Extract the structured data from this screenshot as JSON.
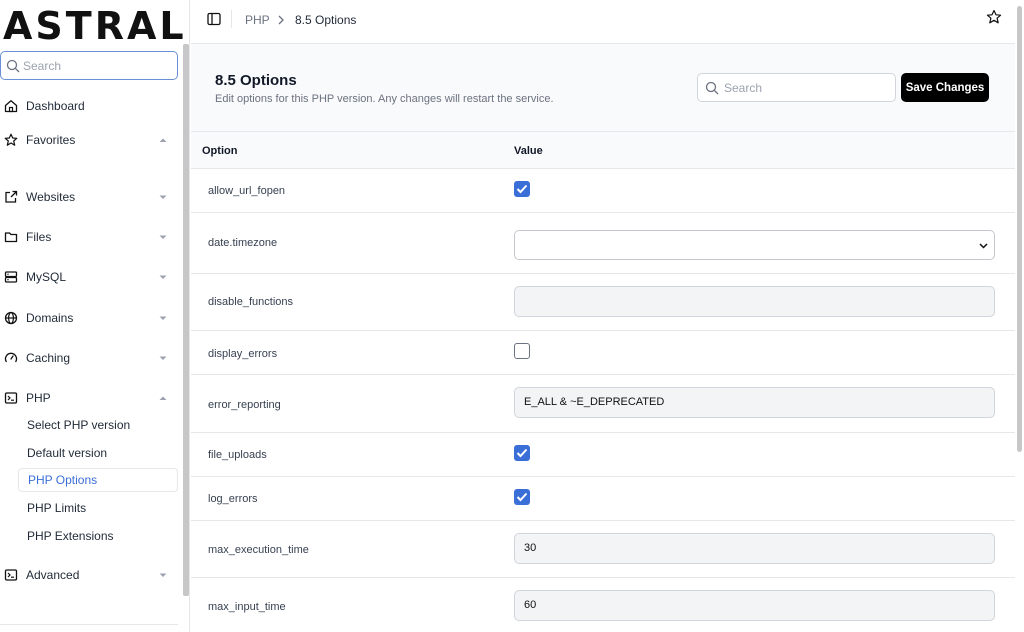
{
  "brand": {
    "logo_text": "ASTRAL"
  },
  "sidebar": {
    "search_placeholder": "Search",
    "items": [
      {
        "label": "Dashboard",
        "icon": "home-icon"
      },
      {
        "label": "Favorites",
        "icon": "star-icon",
        "expanded": true
      },
      {
        "label": "Websites",
        "icon": "external-link-icon",
        "expanded": false
      },
      {
        "label": "Files",
        "icon": "folder-icon",
        "expanded": false
      },
      {
        "label": "MySQL",
        "icon": "server-icon",
        "expanded": false
      },
      {
        "label": "Domains",
        "icon": "globe-icon",
        "expanded": false
      },
      {
        "label": "Caching",
        "icon": "gauge-icon",
        "expanded": false
      },
      {
        "label": "PHP",
        "icon": "terminal-icon",
        "expanded": true
      },
      {
        "label": "Advanced",
        "icon": "terminal-icon",
        "expanded": false
      }
    ],
    "php_subitems": [
      {
        "label": "Select PHP version",
        "active": false
      },
      {
        "label": "Default version",
        "active": false
      },
      {
        "label": "PHP Options",
        "active": true
      },
      {
        "label": "PHP Limits",
        "active": false
      },
      {
        "label": "PHP Extensions",
        "active": false
      }
    ]
  },
  "topbar": {
    "breadcrumb": [
      "PHP",
      "8.5 Options"
    ]
  },
  "page": {
    "title": "8.5 Options",
    "description": "Edit options for this PHP version. Any changes will restart the service.",
    "search_placeholder": "Search",
    "save_label": "Save Changes"
  },
  "table": {
    "headers": {
      "option": "Option",
      "value": "Value"
    },
    "rows": [
      {
        "name": "allow_url_fopen",
        "type": "checkbox",
        "checked": true
      },
      {
        "name": "date.timezone",
        "type": "select",
        "value": ""
      },
      {
        "name": "disable_functions",
        "type": "text",
        "value": ""
      },
      {
        "name": "display_errors",
        "type": "checkbox",
        "checked": false
      },
      {
        "name": "error_reporting",
        "type": "text",
        "value": "E_ALL & ~E_DEPRECATED"
      },
      {
        "name": "file_uploads",
        "type": "checkbox",
        "checked": true
      },
      {
        "name": "log_errors",
        "type": "checkbox",
        "checked": true
      },
      {
        "name": "max_execution_time",
        "type": "text",
        "value": "30"
      },
      {
        "name": "max_input_time",
        "type": "text",
        "value": "60"
      }
    ]
  },
  "colors": {
    "accent": "#3b6fd8",
    "primary_button": "#000000"
  }
}
